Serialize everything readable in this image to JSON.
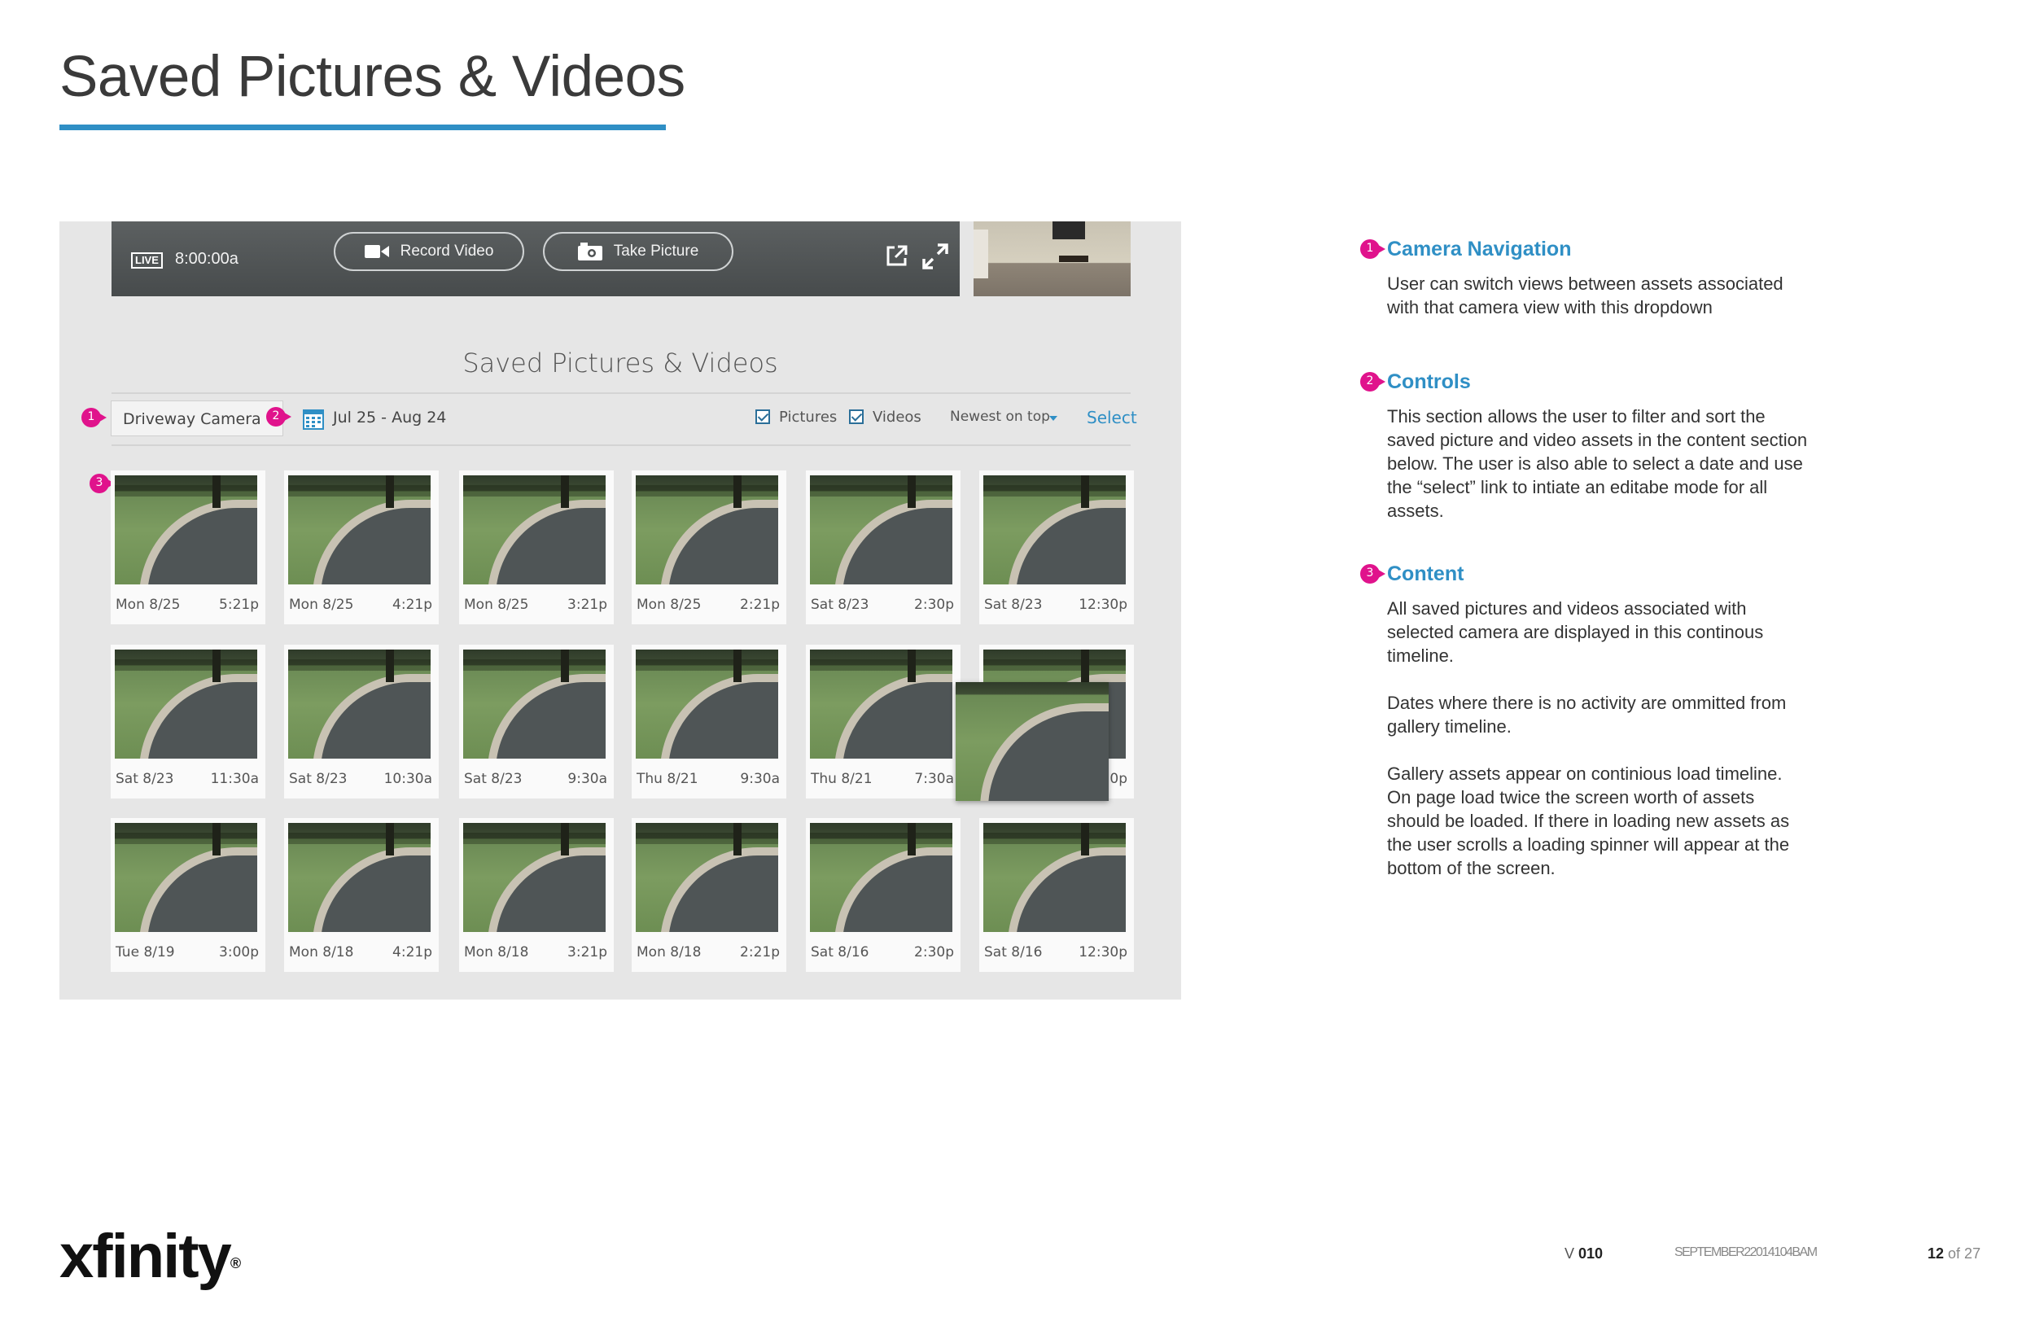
{
  "page": {
    "title": "Saved Pictures & Videos"
  },
  "mockup": {
    "player": {
      "live_badge": "LIVE",
      "timestamp": "8:00:00a",
      "record_label": "Record Video",
      "picture_label": "Take Picture"
    },
    "gallery_heading": "Saved Pictures & Videos",
    "toolbar": {
      "camera_selected": "Driveway Camera",
      "date_range": "Jul 25 - Aug 24",
      "pictures_label": "Pictures",
      "pictures_checked": true,
      "videos_label": "Videos",
      "videos_checked": true,
      "sort_label": "Newest on top",
      "select_label": "Select"
    },
    "markers": [
      "1",
      "2",
      "3"
    ],
    "tiles": [
      {
        "day": "Mon 8/25",
        "time": "5:21p"
      },
      {
        "day": "Mon 8/25",
        "time": "4:21p"
      },
      {
        "day": "Mon 8/25",
        "time": "3:21p"
      },
      {
        "day": "Mon 8/25",
        "time": "2:21p"
      },
      {
        "day": "Sat 8/23",
        "time": "2:30p"
      },
      {
        "day": "Sat 8/23",
        "time": "12:30p"
      },
      {
        "day": "Sat 8/23",
        "time": "11:30a"
      },
      {
        "day": "Sat 8/23",
        "time": "10:30a"
      },
      {
        "day": "Sat 8/23",
        "time": "9:30a"
      },
      {
        "day": "Thu 8/21",
        "time": "9:30a"
      },
      {
        "day": "Thu 8/21",
        "time": "7:30a"
      },
      {
        "day": "",
        "time": "0p"
      },
      {
        "day": "Tue 8/19",
        "time": "3:00p"
      },
      {
        "day": "Mon 8/18",
        "time": "4:21p"
      },
      {
        "day": "Mon 8/18",
        "time": "3:21p"
      },
      {
        "day": "Mon 8/18",
        "time": "2:21p"
      },
      {
        "day": "Sat 8/16",
        "time": "2:30p"
      },
      {
        "day": "Sat 8/16",
        "time": "12:30p"
      }
    ]
  },
  "annotations": [
    {
      "number": "1",
      "heading": "Camera Navigation",
      "paragraphs": [
        "User can switch views between assets associated with that camera view with this dropdown"
      ]
    },
    {
      "number": "2",
      "heading": "Controls",
      "paragraphs": [
        "This section allows the user to filter and sort the saved picture and video assets in the content section below. The user is also able to select a date and use the “select” link to intiate an editabe mode for all assets."
      ]
    },
    {
      "number": "3",
      "heading": "Content",
      "paragraphs": [
        "All saved pictures and videos associated with selected camera are displayed in this continous timeline.",
        "Dates where there is no activity are ommitted from gallery timeline.",
        "Gallery assets appear on continious load timeline. On page load twice the screen worth of assets should be loaded. If there in loading new assets as the user scrolls a loading spinner will appear at the bottom of the screen."
      ]
    }
  ],
  "footer": {
    "logo": "xfinity",
    "version_prefix": "V",
    "version": "010",
    "date": "SEPTEMBER22014104BAM",
    "page_current": "12",
    "page_of": "of 27"
  },
  "colors": {
    "accent_blue": "#2f8fc5",
    "marker_pink": "#e0138c"
  }
}
